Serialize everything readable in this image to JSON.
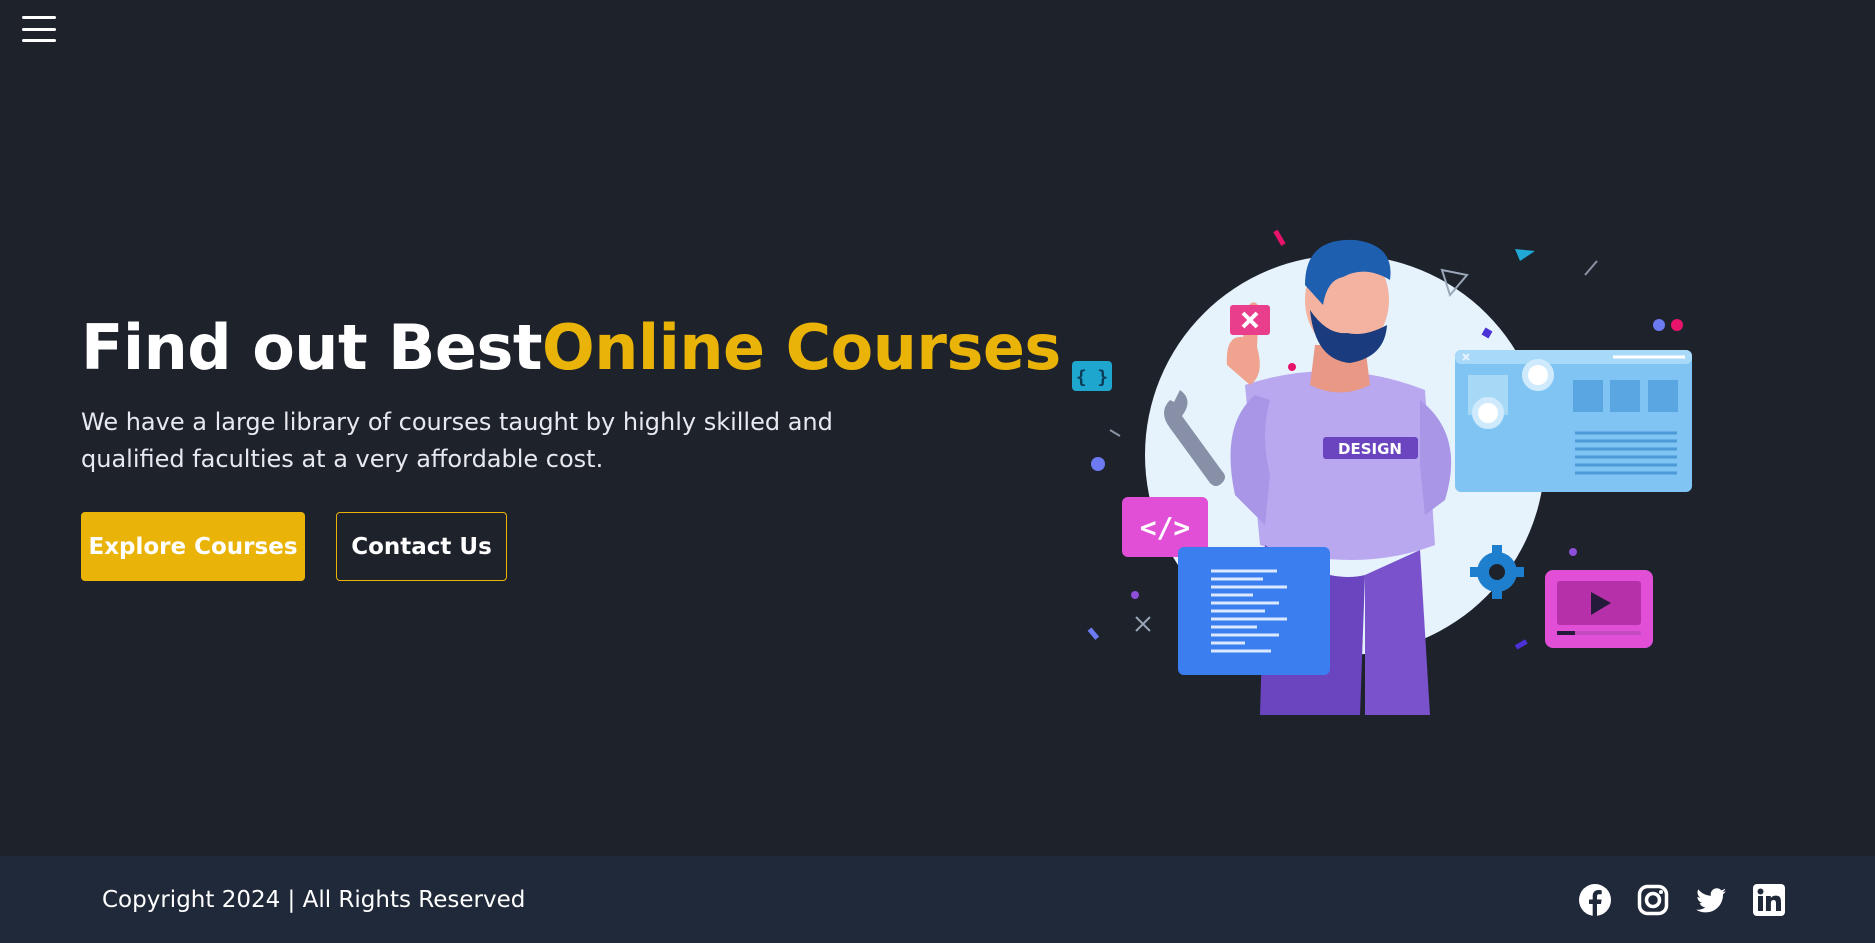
{
  "header": {
    "menu_icon": "hamburger-menu-icon"
  },
  "hero": {
    "title_main": "Find out Best",
    "title_accent": "Online Courses",
    "description": "We have a large library of courses taught by highly skilled and qualified faculties at a very affordable cost.",
    "primary_button": "Explore Courses",
    "secondary_button": "Contact Us"
  },
  "illustration": {
    "sweater_label": "DESIGN",
    "bracket_label": "{ }",
    "code_label": "</>"
  },
  "footer": {
    "copyright": "Copyright 2024 | All Rights Reserved",
    "social_icons": [
      "facebook-icon",
      "instagram-icon",
      "twitter-icon",
      "linkedin-icon"
    ]
  },
  "colors": {
    "background": "#1e222b",
    "footer_background": "#20293a",
    "accent": "#eab308"
  }
}
